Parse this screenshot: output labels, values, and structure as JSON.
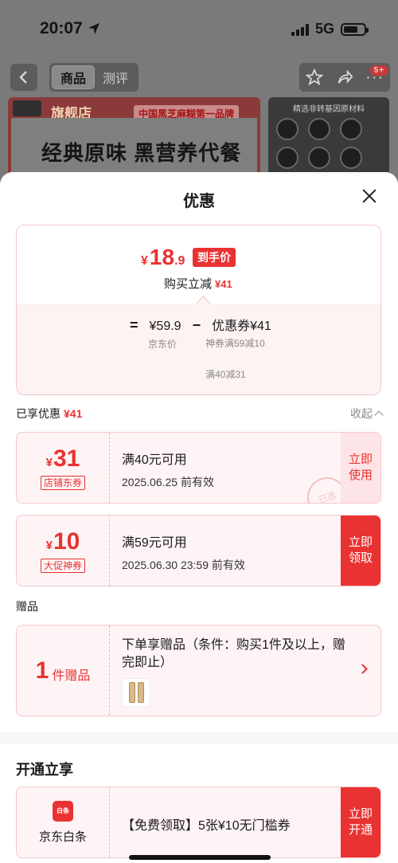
{
  "status_bar": {
    "time": "20:07",
    "network": "5G"
  },
  "nav": {
    "back_icon": "chevron-left-icon",
    "tabs": [
      {
        "label": "商品",
        "active": true
      },
      {
        "label": "测评",
        "active": false
      }
    ],
    "badge": "5+"
  },
  "background": {
    "banner_store": "旗舰店",
    "banner_tag": "中国黑芝麻糊第一品牌",
    "banner_title": "经典原味 黑营养代餐",
    "side_banner_title": "精选非转基因原材料"
  },
  "sheet": {
    "title": "优惠",
    "price_summary": {
      "yen": "¥",
      "final_int": "18",
      "final_dec": ".9",
      "final_tag": "到手价",
      "reduce_label": "购买立减",
      "reduce_amount": "¥41",
      "eq": "=",
      "jd_price": "¥59.9",
      "minus": "−",
      "coupon_total": "优惠券¥41",
      "jd_price_label": "京东价",
      "coupon_detail_1": "神券满59减10",
      "coupon_detail_2": "满40减31"
    },
    "enjoyed": {
      "label": "已享优惠",
      "amount": "¥41",
      "collapse_label": "收起"
    },
    "coupons": [
      {
        "yen": "¥",
        "amount": "31",
        "type": "店铺东券",
        "condition": "满40元可用",
        "validity": "2025.06.25 前有效",
        "button": "立即使用",
        "button_style": "ghost",
        "stamp": "已选"
      },
      {
        "yen": "¥",
        "amount": "10",
        "type": "大促神券",
        "condition": "满59元可用",
        "validity": "2025.06.30 23:59 前有效",
        "button": "立即领取",
        "button_style": "solid"
      }
    ],
    "gift": {
      "section_label": "赠品",
      "count": "1",
      "unit": "件赠品",
      "description": "下单享赠品（条件：购买1件及以上，赠完即止）"
    },
    "open": {
      "title": "开通立享",
      "logo_text": "白条",
      "name": "京东白条",
      "description": "【免费领取】5张¥10无门槛券",
      "button": "立即开通"
    }
  },
  "colors": {
    "accent": "#e93232",
    "card_bg": "#fff4f5",
    "card_border": "#f4c9cc"
  }
}
